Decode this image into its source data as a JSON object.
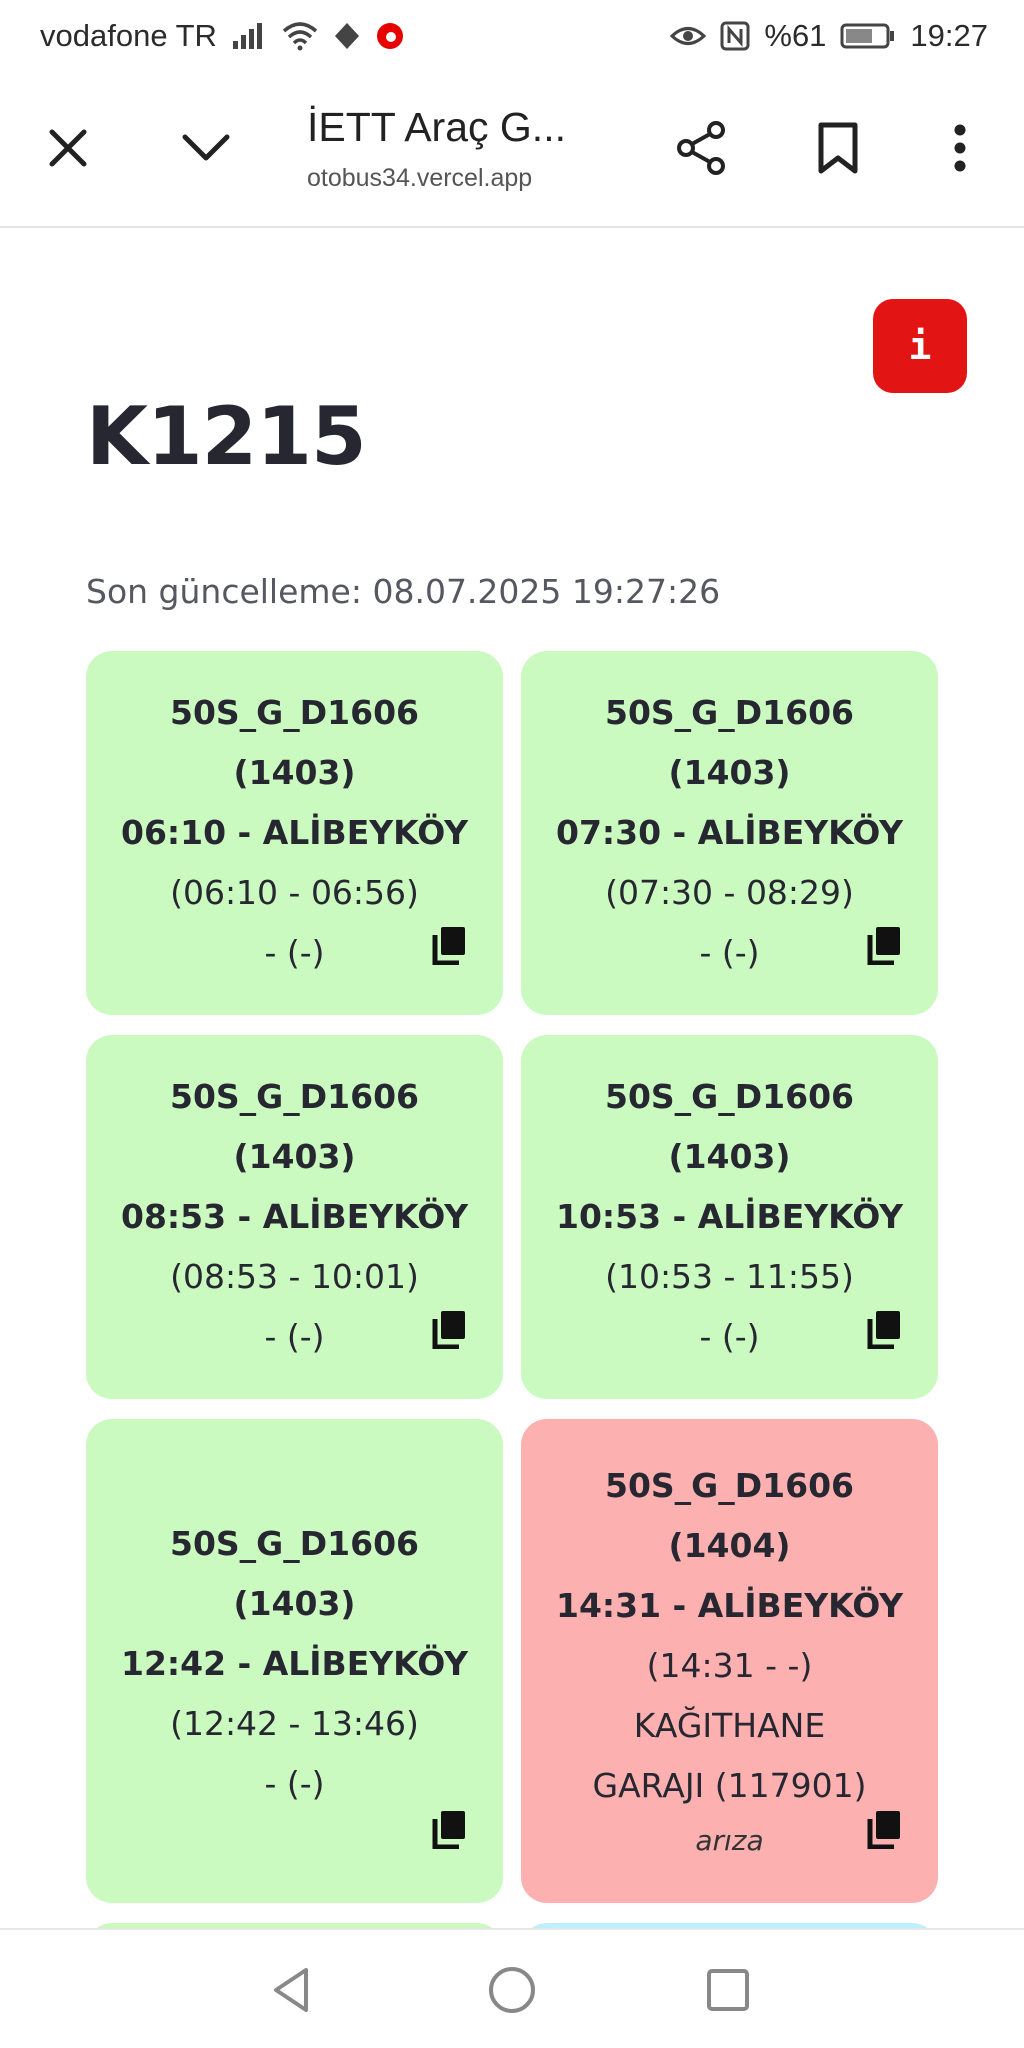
{
  "status_bar": {
    "carrier": "vodafone TR",
    "battery_percent": "%61",
    "time": "19:27",
    "icons": [
      "signal-icon",
      "wifi-icon",
      "data-saver-icon",
      "vodafone-icon",
      "eye-icon",
      "nfc-icon",
      "battery-icon"
    ]
  },
  "browser": {
    "title": "İETT Araç G...",
    "url": "otobus34.vercel.app",
    "icons": [
      "close-icon",
      "chevron-down-icon",
      "share-icon",
      "bookmark-icon",
      "more-vert-icon"
    ]
  },
  "page": {
    "info_label": "i",
    "title": "K1215",
    "updated": "Son güncelleme: 08.07.2025 19:27:26"
  },
  "cards": [
    {
      "status": "green",
      "lines": [
        "50S_G_D1606",
        "(1403)",
        "06:10 - ALİBEYKÖY",
        "(06:10 - 06:56)",
        "- (-)"
      ],
      "bold_count": 3,
      "note": ""
    },
    {
      "status": "green",
      "lines": [
        "50S_G_D1606",
        "(1403)",
        "07:30 - ALİBEYKÖY",
        "(07:30 - 08:29)",
        "- (-)"
      ],
      "bold_count": 3,
      "note": ""
    },
    {
      "status": "green",
      "lines": [
        "50S_G_D1606",
        "(1403)",
        "08:53 - ALİBEYKÖY",
        "(08:53 - 10:01)",
        "- (-)"
      ],
      "bold_count": 3,
      "note": ""
    },
    {
      "status": "green",
      "lines": [
        "50S_G_D1606",
        "(1403)",
        "10:53 - ALİBEYKÖY",
        "(10:53 - 11:55)",
        "- (-)"
      ],
      "bold_count": 3,
      "note": ""
    },
    {
      "status": "green",
      "lines": [
        "50S_G_D1606",
        "(1403)",
        "12:42 - ALİBEYKÖY",
        "(12:42 - 13:46)",
        "- (-)"
      ],
      "bold_count": 3,
      "note": ""
    },
    {
      "status": "red",
      "lines": [
        "50S_G_D1606",
        "(1404)",
        "14:31 - ALİBEYKÖY",
        "(14:31 - -)",
        "KAĞITHANE",
        "GARAJI (117901)"
      ],
      "bold_count": 3,
      "note": "arıza"
    },
    {
      "status": "green",
      "lines": [],
      "bold_count": 0,
      "note": ""
    },
    {
      "status": "blue",
      "lines": [],
      "bold_count": 0,
      "note": ""
    }
  ],
  "colors": {
    "green_card": "#cbfac0",
    "red_card": "#fdb0b0",
    "blue_card": "#bdf0fa",
    "info_button": "#e31414"
  },
  "nav_bar": {
    "icons": [
      "back-triangle-icon",
      "home-circle-icon",
      "recents-square-icon"
    ]
  }
}
